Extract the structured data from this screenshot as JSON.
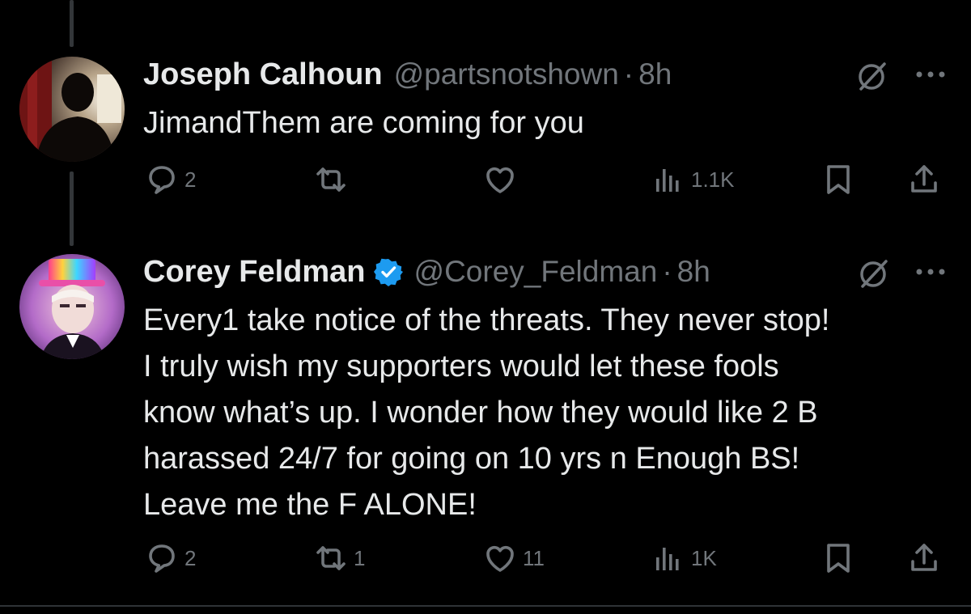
{
  "colors": {
    "background": "#000000",
    "text_primary": "#e7e9ea",
    "text_secondary": "#71767b",
    "verified_blue": "#1d9bf0",
    "thread_line": "#333639"
  },
  "tweets": [
    {
      "author_name": "Joseph Calhoun",
      "handle": "@partsnotshown",
      "separator": "·",
      "time": "8h",
      "verified": false,
      "body_lines": [
        "JimandThem are coming for you"
      ],
      "actions": {
        "reply_icon": "reply-icon",
        "reply_count": "2",
        "retweet_icon": "retweet-icon",
        "retweet_count": "",
        "like_icon": "heart-icon",
        "like_count": "",
        "views_icon": "analytics-icon",
        "views_count": "1.1K",
        "bookmark_icon": "bookmark-icon",
        "share_icon": "share-icon"
      }
    },
    {
      "author_name": "Corey Feldman",
      "handle": "@Corey_Feldman",
      "separator": "·",
      "time": "8h",
      "verified": true,
      "body_lines": [
        "Every1 take notice of the threats. They never stop!",
        "I truly wish my supporters would let these fools",
        "know what’s up. I wonder how they would like 2 B",
        "harassed 24/7 for going on 10 yrs n Enough BS!",
        "Leave me the F ALONE!"
      ],
      "actions": {
        "reply_icon": "reply-icon",
        "reply_count": "2",
        "retweet_icon": "retweet-icon",
        "retweet_count": "1",
        "like_icon": "heart-icon",
        "like_count": "11",
        "views_icon": "analytics-icon",
        "views_count": "1K",
        "bookmark_icon": "bookmark-icon",
        "share_icon": "share-icon"
      }
    }
  ]
}
